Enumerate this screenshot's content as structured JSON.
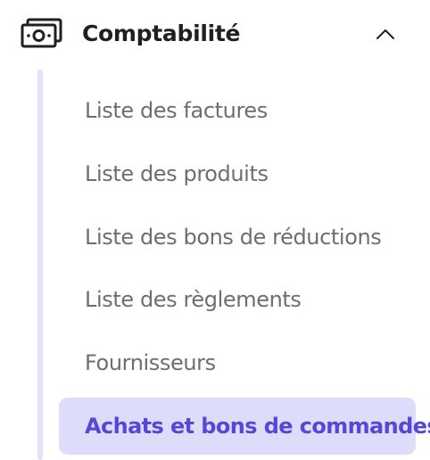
{
  "section": {
    "title": "Comptabilité",
    "icon": "cash-icon",
    "expanded": true,
    "chevron_icon": "chevron-up-icon"
  },
  "items": [
    {
      "label": "Liste des factures",
      "active": false
    },
    {
      "label": "Liste des produits",
      "active": false
    },
    {
      "label": "Liste des bons de réductions",
      "active": false
    },
    {
      "label": "Liste des règlements",
      "active": false
    },
    {
      "label": "Fournisseurs",
      "active": false
    },
    {
      "label": "Achats et bons de commandes",
      "active": true
    }
  ],
  "colors": {
    "accent": "#5548d8",
    "active_background": "#ddddfb",
    "tree_line": "#e4e2fb",
    "text": "#6c6e72",
    "title": "#1f2023"
  }
}
